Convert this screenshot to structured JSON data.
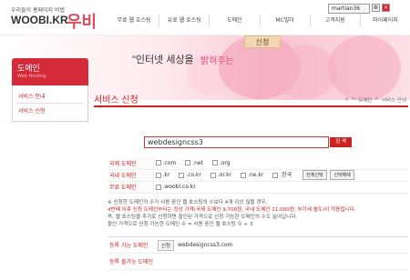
{
  "header": {
    "logo_tagline": "우리들이 홈페이지 비법",
    "logo_name": "WOOBI.KR",
    "logo_mark": "우비",
    "user": "martian36",
    "gnb": [
      "무료 웹 호스팅",
      "유료 웹 호스팅",
      "도메인",
      "MC빌더",
      "고객지원",
      "마이페이지"
    ]
  },
  "banner": {
    "tag": "신청",
    "slogan": "\"인터넷 세상을",
    "slogan_pink": "밝혀주는"
  },
  "sidebar": {
    "title": "도메인",
    "subtitle": "Web Hosting",
    "items": [
      "서비스 안내",
      "서비스 신청"
    ]
  },
  "main": {
    "title": "서비스 신청",
    "breadcrumb": [
      "도메인",
      "서비스 안내"
    ],
    "search_value": "webdesigncss3",
    "search_button": "검 색"
  },
  "tld_rows": [
    {
      "label": "국제 도메인",
      "options": [
        ".com",
        ".net",
        ".org"
      ]
    },
    {
      "label": "국내 도메인",
      "options": [
        ".kr",
        ".co.kr",
        ".or.kr",
        ".ne.kr",
        ".한국"
      ],
      "buttons": [
        "전체선택",
        "선택해제"
      ]
    },
    {
      "label": "무료 도메인",
      "options": [
        ".woobi.co.kr"
      ]
    }
  ],
  "notice": {
    "line1": "※ 신청한 도메인의 수가 사용 중인 웹 호스팅의 수보다 4개 이상 많을 경우,",
    "line2": "4번째 이후 신청 도메인부터는 정상 가격(국제 도메인 9,700원, 국내 도메인 11,000원, 부가세 별도)이 적용됩니다.",
    "line3": "즉, 웹 호스팅을 추가로 신청하면 할인된 가격으로 신청 가능한 도메인의 수도 늘어납니다.",
    "line4": "할인 가격으로 신청 가능한 도메인 수 = 사용 중인 웹 호스팅 수 + 3"
  },
  "applied": {
    "label1": "등록 가능 도메인",
    "badge": "신청",
    "domain": "webdesigncss3.com",
    "label2": "등록 불가능 도메인"
  }
}
